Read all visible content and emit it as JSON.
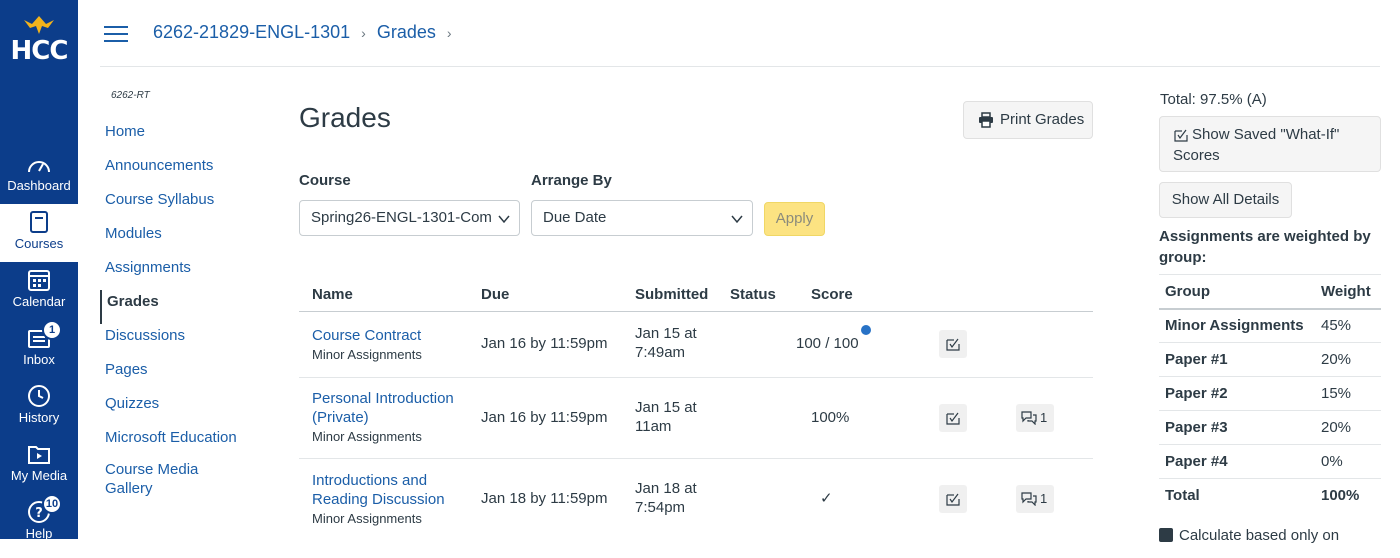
{
  "global_nav": {
    "logo_text": "HCC",
    "items": [
      {
        "label": "Dashboard",
        "icon": "dashboard-icon"
      },
      {
        "label": "Courses",
        "icon": "courses-icon"
      },
      {
        "label": "Calendar",
        "icon": "calendar-icon"
      },
      {
        "label": "Inbox",
        "icon": "inbox-icon",
        "badge": "1"
      },
      {
        "label": "History",
        "icon": "history-icon"
      },
      {
        "label": "My Media",
        "icon": "media-icon"
      },
      {
        "label": "Help",
        "icon": "help-icon",
        "badge": "10"
      }
    ]
  },
  "breadcrumb": [
    "6262-21829-ENGL-1301",
    "Grades"
  ],
  "course_nav": {
    "code": "6262-RT",
    "items": [
      "Home",
      "Announcements",
      "Course Syllabus",
      "Modules",
      "Assignments",
      "Grades",
      "Discussions",
      "Pages",
      "Quizzes",
      "Microsoft Education",
      "Course Media Gallery"
    ],
    "active": "Grades"
  },
  "page": {
    "title": "Grades",
    "print_label": "Print Grades",
    "course_label": "Course",
    "course_value": "Spring26-ENGL-1301-Com",
    "arrange_label": "Arrange By",
    "arrange_value": "Due Date",
    "apply_label": "Apply"
  },
  "table": {
    "headers": [
      "Name",
      "Due",
      "Submitted",
      "Status",
      "Score"
    ],
    "rows": [
      {
        "name": "Course Contract",
        "group": "Minor Assignments",
        "due": "Jan 16 by 11:59pm",
        "submitted": "Jan 15 at 7:49am",
        "score": "100 / 100",
        "comments": ""
      },
      {
        "name": "Personal Introduction (Private)",
        "group": "Minor Assignments",
        "due": "Jan 16 by 11:59pm",
        "submitted": "Jan 15 at 11am",
        "score": "100%",
        "comments": "1"
      },
      {
        "name": "Introductions and Reading Discussion",
        "group": "Minor Assignments",
        "due": "Jan 18 by 11:59pm",
        "submitted": "Jan 18 at 7:54pm",
        "score": "✓",
        "comments": "1"
      }
    ]
  },
  "sidebar": {
    "total": "Total: 97.5% (A)",
    "whatif_label": "Show Saved \"What-If\" Scores",
    "details_label": "Show All Details",
    "weighted_note": "Assignments are weighted by group:",
    "weights_headers": [
      "Group",
      "Weight"
    ],
    "weights": [
      {
        "group": "Minor Assignments",
        "weight": "45%"
      },
      {
        "group": "Paper #1",
        "weight": "20%"
      },
      {
        "group": "Paper #2",
        "weight": "15%"
      },
      {
        "group": "Paper #3",
        "weight": "20%"
      },
      {
        "group": "Paper #4",
        "weight": "0%"
      },
      {
        "group": "Total",
        "weight": "100%"
      }
    ],
    "calc_label": "Calculate based only on"
  }
}
